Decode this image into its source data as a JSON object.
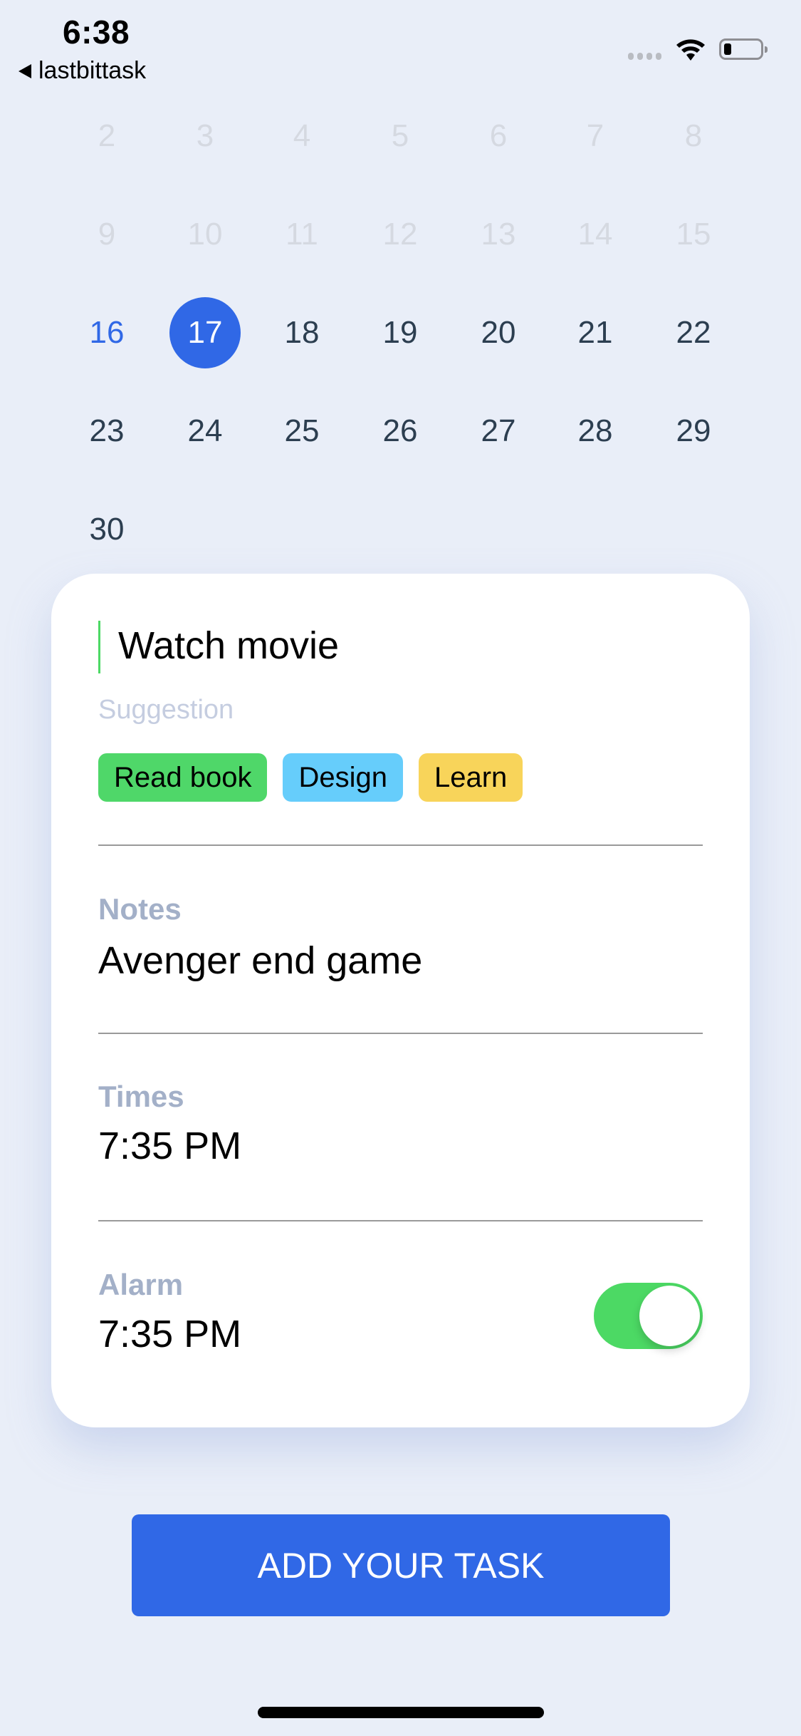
{
  "status_bar": {
    "time": "6:38",
    "back_app": "lastbittask",
    "icons": [
      "signal-icon",
      "wifi-icon",
      "battery-icon"
    ]
  },
  "calendar": {
    "rows": [
      [
        {
          "d": "2",
          "state": "past"
        },
        {
          "d": "3",
          "state": "past"
        },
        {
          "d": "4",
          "state": "past"
        },
        {
          "d": "5",
          "state": "past"
        },
        {
          "d": "6",
          "state": "past"
        },
        {
          "d": "7",
          "state": "past"
        },
        {
          "d": "8",
          "state": "past"
        }
      ],
      [
        {
          "d": "9",
          "state": "past"
        },
        {
          "d": "10",
          "state": "past"
        },
        {
          "d": "11",
          "state": "past"
        },
        {
          "d": "12",
          "state": "past"
        },
        {
          "d": "13",
          "state": "past"
        },
        {
          "d": "14",
          "state": "past"
        },
        {
          "d": "15",
          "state": "past"
        }
      ],
      [
        {
          "d": "16",
          "state": "today"
        },
        {
          "d": "17",
          "state": "selected"
        },
        {
          "d": "18",
          "state": "normal"
        },
        {
          "d": "19",
          "state": "normal"
        },
        {
          "d": "20",
          "state": "normal"
        },
        {
          "d": "21",
          "state": "normal"
        },
        {
          "d": "22",
          "state": "normal"
        }
      ],
      [
        {
          "d": "23",
          "state": "normal"
        },
        {
          "d": "24",
          "state": "normal"
        },
        {
          "d": "25",
          "state": "normal"
        },
        {
          "d": "26",
          "state": "normal"
        },
        {
          "d": "27",
          "state": "normal"
        },
        {
          "d": "28",
          "state": "normal"
        },
        {
          "d": "29",
          "state": "normal"
        }
      ],
      [
        {
          "d": "30",
          "state": "normal"
        }
      ]
    ],
    "selected_day": "17",
    "today": "16"
  },
  "task": {
    "title": "Watch movie",
    "suggestion_label": "Suggestion",
    "suggestions": [
      {
        "label": "Read book",
        "color": "#4fd769"
      },
      {
        "label": "Design",
        "color": "#66cdfb"
      },
      {
        "label": "Learn",
        "color": "#f8d45a"
      }
    ],
    "notes_label": "Notes",
    "notes_value": "Avenger end game",
    "times_label": "Times",
    "times_value": "7:35 PM",
    "alarm_label": "Alarm",
    "alarm_value": "7:35 PM",
    "alarm_enabled": true
  },
  "add_button_label": "ADD YOUR TASK",
  "colors": {
    "accent": "#3068e6",
    "toggle_on": "#4cd964",
    "background": "#e9eef8"
  }
}
